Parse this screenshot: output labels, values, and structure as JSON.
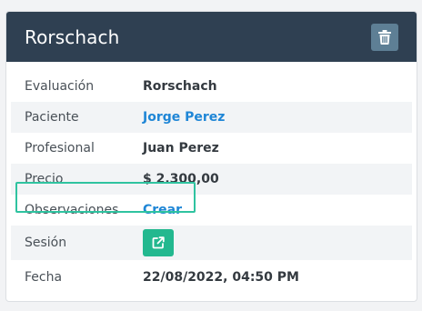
{
  "header": {
    "title": "Rorschach"
  },
  "details": {
    "evaluacion": {
      "label": "Evaluación",
      "value": "Rorschach"
    },
    "paciente": {
      "label": "Paciente",
      "value": "Jorge Perez"
    },
    "profesional": {
      "label": "Profesional",
      "value": "Juan Perez"
    },
    "precio": {
      "label": "Precio",
      "value": "$ 2.300,00"
    },
    "observaciones": {
      "label": "Observaciones",
      "value": "Crear"
    },
    "sesion": {
      "label": "Sesión"
    },
    "fecha": {
      "label": "Fecha",
      "value": "22/08/2022, 04:50 PM"
    }
  },
  "colors": {
    "header_bg": "#2f4052",
    "link": "#1f86d6",
    "accent_green": "#23b88f",
    "highlight_border": "#2fc3a0"
  },
  "icons": {
    "delete": "trash-icon",
    "session": "external-link-icon"
  }
}
